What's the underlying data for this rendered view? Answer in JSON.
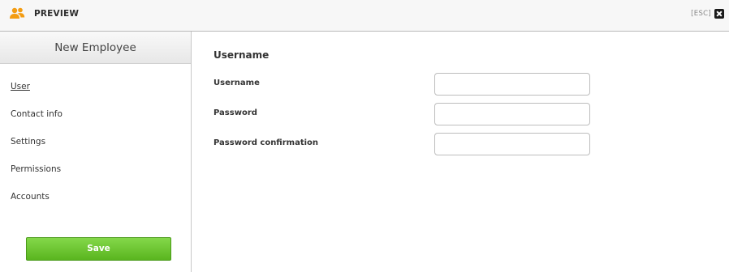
{
  "header": {
    "title": "PREVIEW",
    "icon": "users-icon",
    "accent_color": "#f39c12",
    "esc_label": "[ESC]",
    "close_icon": "close-icon"
  },
  "sidebar": {
    "title": "New Employee",
    "items": [
      {
        "label": "User",
        "active": true
      },
      {
        "label": "Contact info",
        "active": false
      },
      {
        "label": "Settings",
        "active": false
      },
      {
        "label": "Permissions",
        "active": false
      },
      {
        "label": "Accounts",
        "active": false
      }
    ],
    "save_label": "Save",
    "save_color": "#6cc52e"
  },
  "form": {
    "section_title": "Username",
    "fields": [
      {
        "label": "Username",
        "value": "",
        "placeholder": ""
      },
      {
        "label": "Password",
        "value": "",
        "placeholder": ""
      },
      {
        "label": "Password confirmation",
        "value": "",
        "placeholder": ""
      }
    ]
  }
}
